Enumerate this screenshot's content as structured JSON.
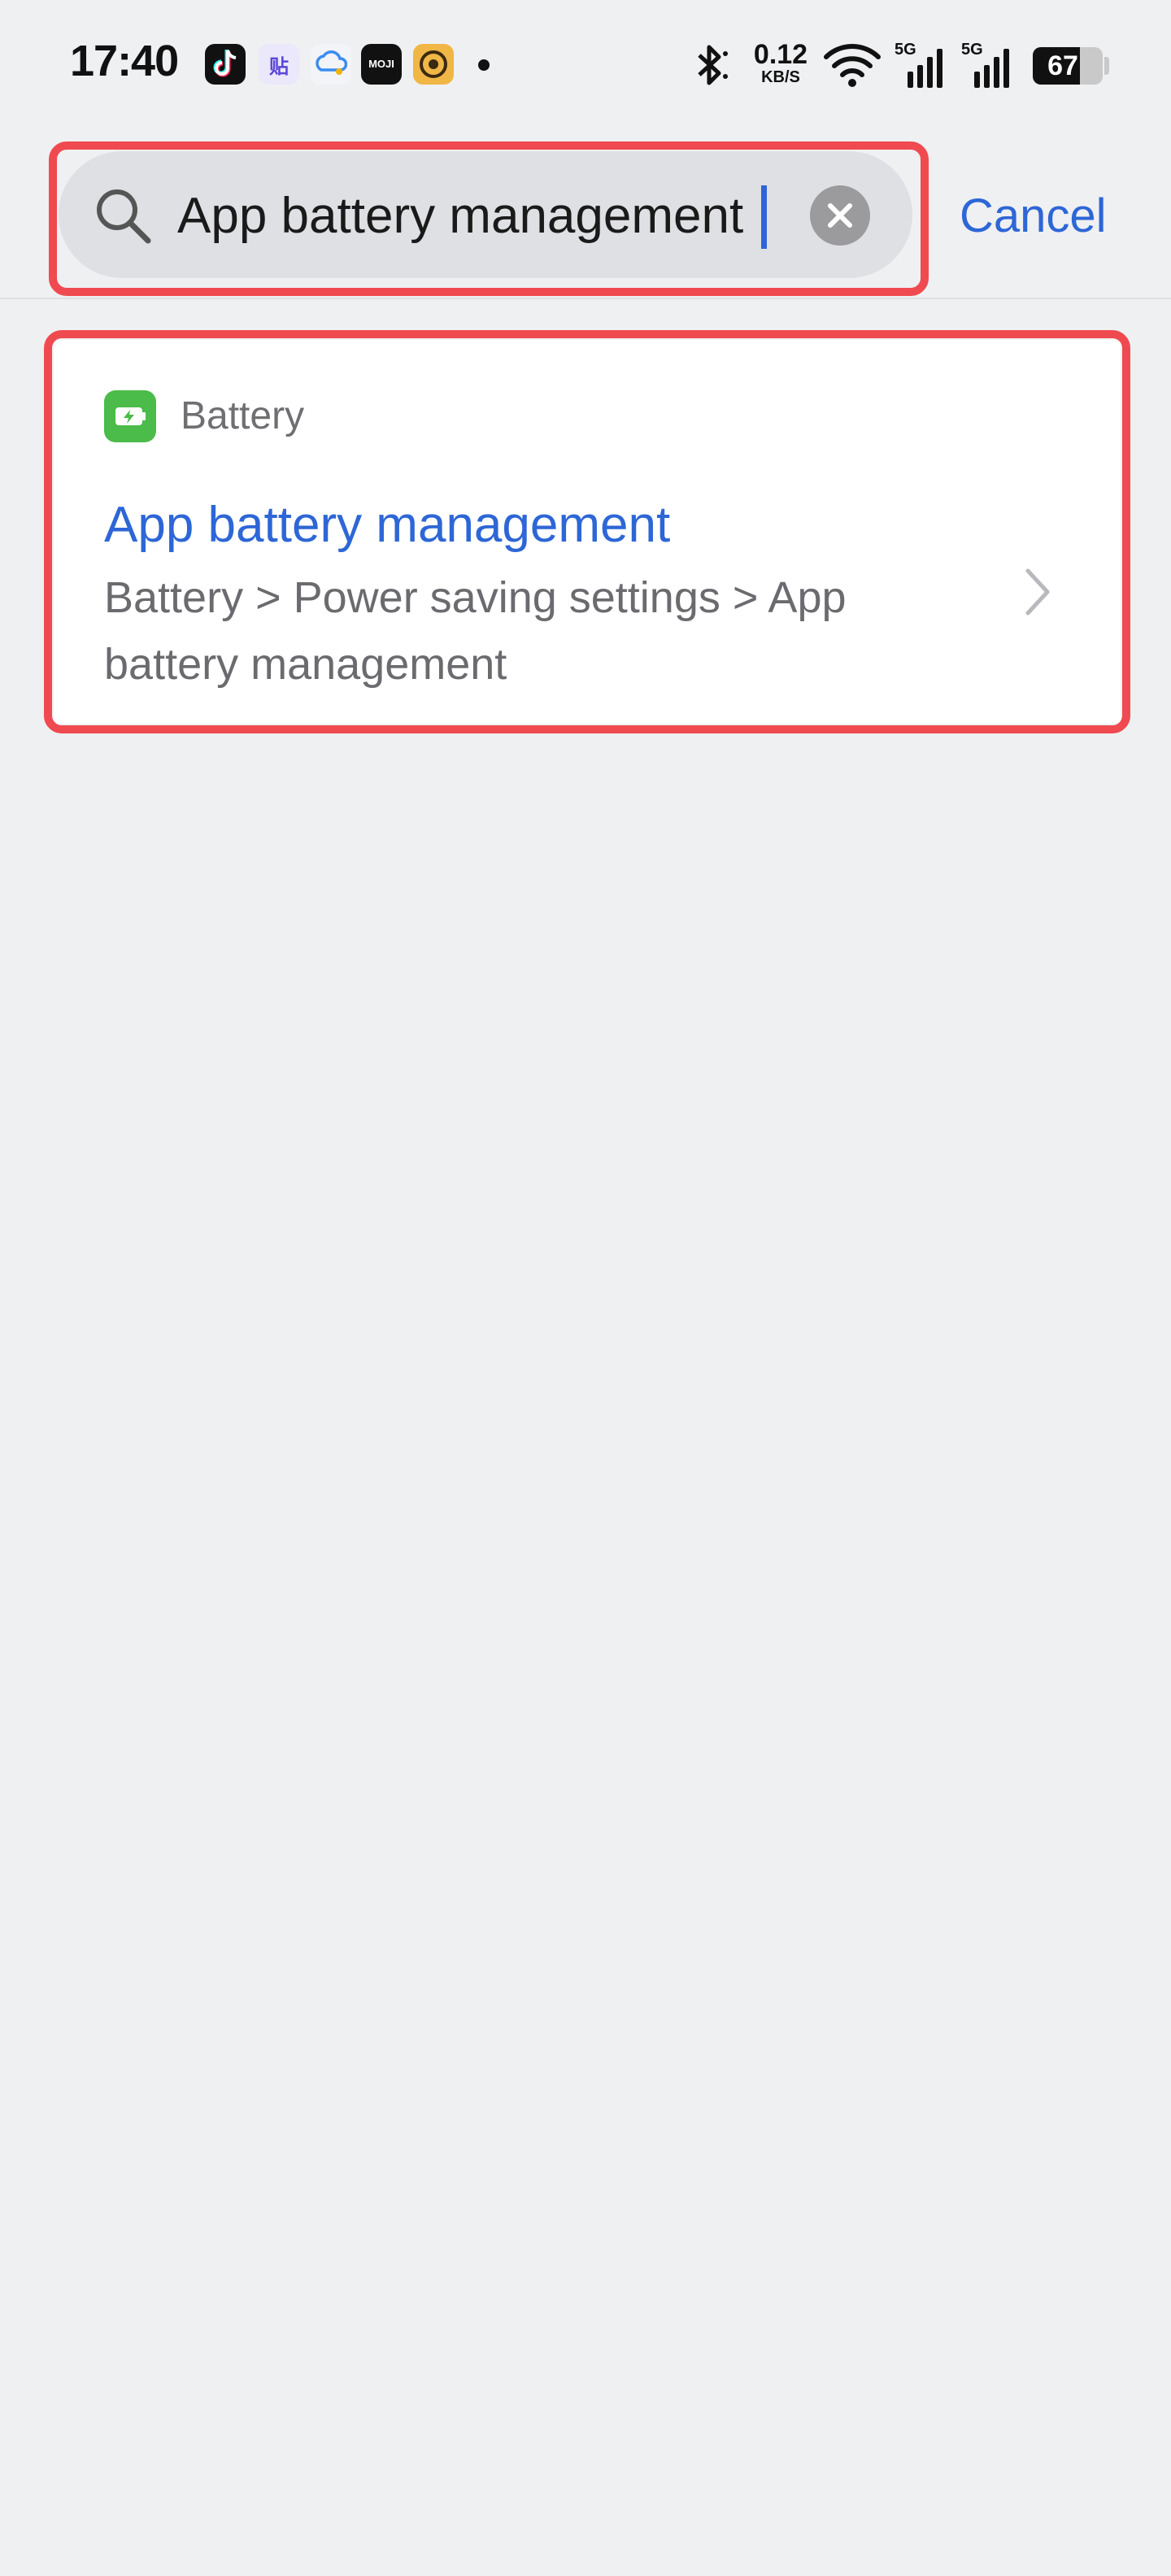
{
  "status_bar": {
    "time": "17:40",
    "notification_icons": [
      "tiktok-icon",
      "tieba-icon",
      "cloud-chat-icon",
      "moji-weather-icon",
      "music-icon"
    ],
    "moji_label": "MOJI",
    "tieba_label": "贴",
    "net_speed_value": "0.12",
    "net_speed_unit": "KB/S",
    "signal_1_label": "5G",
    "signal_2_label": "5G",
    "battery_level": "67",
    "battery_fraction": 0.67
  },
  "search": {
    "query": "App battery management",
    "cancel_label": "Cancel"
  },
  "results": [
    {
      "category": "Battery",
      "title": "App battery management",
      "path": "Battery > Power saving settings > App battery management"
    }
  ],
  "colors": {
    "accent": "#2d66d6",
    "highlight_outline": "#ef4a4f",
    "battery_icon": "#4bbb4a",
    "background": "#eff0f2"
  }
}
